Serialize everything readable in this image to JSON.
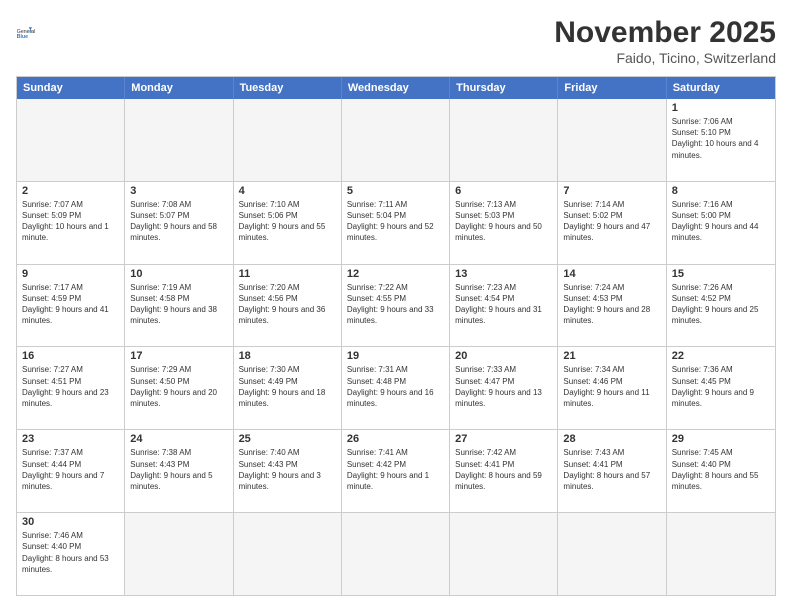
{
  "header": {
    "logo_general": "General",
    "logo_blue": "Blue",
    "month_year": "November 2025",
    "location": "Faido, Ticino, Switzerland"
  },
  "weekdays": [
    "Sunday",
    "Monday",
    "Tuesday",
    "Wednesday",
    "Thursday",
    "Friday",
    "Saturday"
  ],
  "weeks": [
    [
      {
        "day": "",
        "text": ""
      },
      {
        "day": "",
        "text": ""
      },
      {
        "day": "",
        "text": ""
      },
      {
        "day": "",
        "text": ""
      },
      {
        "day": "",
        "text": ""
      },
      {
        "day": "",
        "text": ""
      },
      {
        "day": "1",
        "text": "Sunrise: 7:06 AM\nSunset: 5:10 PM\nDaylight: 10 hours and 4 minutes."
      }
    ],
    [
      {
        "day": "2",
        "text": "Sunrise: 7:07 AM\nSunset: 5:09 PM\nDaylight: 10 hours and 1 minute."
      },
      {
        "day": "3",
        "text": "Sunrise: 7:08 AM\nSunset: 5:07 PM\nDaylight: 9 hours and 58 minutes."
      },
      {
        "day": "4",
        "text": "Sunrise: 7:10 AM\nSunset: 5:06 PM\nDaylight: 9 hours and 55 minutes."
      },
      {
        "day": "5",
        "text": "Sunrise: 7:11 AM\nSunset: 5:04 PM\nDaylight: 9 hours and 52 minutes."
      },
      {
        "day": "6",
        "text": "Sunrise: 7:13 AM\nSunset: 5:03 PM\nDaylight: 9 hours and 50 minutes."
      },
      {
        "day": "7",
        "text": "Sunrise: 7:14 AM\nSunset: 5:02 PM\nDaylight: 9 hours and 47 minutes."
      },
      {
        "day": "8",
        "text": "Sunrise: 7:16 AM\nSunset: 5:00 PM\nDaylight: 9 hours and 44 minutes."
      }
    ],
    [
      {
        "day": "9",
        "text": "Sunrise: 7:17 AM\nSunset: 4:59 PM\nDaylight: 9 hours and 41 minutes."
      },
      {
        "day": "10",
        "text": "Sunrise: 7:19 AM\nSunset: 4:58 PM\nDaylight: 9 hours and 38 minutes."
      },
      {
        "day": "11",
        "text": "Sunrise: 7:20 AM\nSunset: 4:56 PM\nDaylight: 9 hours and 36 minutes."
      },
      {
        "day": "12",
        "text": "Sunrise: 7:22 AM\nSunset: 4:55 PM\nDaylight: 9 hours and 33 minutes."
      },
      {
        "day": "13",
        "text": "Sunrise: 7:23 AM\nSunset: 4:54 PM\nDaylight: 9 hours and 31 minutes."
      },
      {
        "day": "14",
        "text": "Sunrise: 7:24 AM\nSunset: 4:53 PM\nDaylight: 9 hours and 28 minutes."
      },
      {
        "day": "15",
        "text": "Sunrise: 7:26 AM\nSunset: 4:52 PM\nDaylight: 9 hours and 25 minutes."
      }
    ],
    [
      {
        "day": "16",
        "text": "Sunrise: 7:27 AM\nSunset: 4:51 PM\nDaylight: 9 hours and 23 minutes."
      },
      {
        "day": "17",
        "text": "Sunrise: 7:29 AM\nSunset: 4:50 PM\nDaylight: 9 hours and 20 minutes."
      },
      {
        "day": "18",
        "text": "Sunrise: 7:30 AM\nSunset: 4:49 PM\nDaylight: 9 hours and 18 minutes."
      },
      {
        "day": "19",
        "text": "Sunrise: 7:31 AM\nSunset: 4:48 PM\nDaylight: 9 hours and 16 minutes."
      },
      {
        "day": "20",
        "text": "Sunrise: 7:33 AM\nSunset: 4:47 PM\nDaylight: 9 hours and 13 minutes."
      },
      {
        "day": "21",
        "text": "Sunrise: 7:34 AM\nSunset: 4:46 PM\nDaylight: 9 hours and 11 minutes."
      },
      {
        "day": "22",
        "text": "Sunrise: 7:36 AM\nSunset: 4:45 PM\nDaylight: 9 hours and 9 minutes."
      }
    ],
    [
      {
        "day": "23",
        "text": "Sunrise: 7:37 AM\nSunset: 4:44 PM\nDaylight: 9 hours and 7 minutes."
      },
      {
        "day": "24",
        "text": "Sunrise: 7:38 AM\nSunset: 4:43 PM\nDaylight: 9 hours and 5 minutes."
      },
      {
        "day": "25",
        "text": "Sunrise: 7:40 AM\nSunset: 4:43 PM\nDaylight: 9 hours and 3 minutes."
      },
      {
        "day": "26",
        "text": "Sunrise: 7:41 AM\nSunset: 4:42 PM\nDaylight: 9 hours and 1 minute."
      },
      {
        "day": "27",
        "text": "Sunrise: 7:42 AM\nSunset: 4:41 PM\nDaylight: 8 hours and 59 minutes."
      },
      {
        "day": "28",
        "text": "Sunrise: 7:43 AM\nSunset: 4:41 PM\nDaylight: 8 hours and 57 minutes."
      },
      {
        "day": "29",
        "text": "Sunrise: 7:45 AM\nSunset: 4:40 PM\nDaylight: 8 hours and 55 minutes."
      }
    ],
    [
      {
        "day": "30",
        "text": "Sunrise: 7:46 AM\nSunset: 4:40 PM\nDaylight: 8 hours and 53 minutes."
      },
      {
        "day": "",
        "text": ""
      },
      {
        "day": "",
        "text": ""
      },
      {
        "day": "",
        "text": ""
      },
      {
        "day": "",
        "text": ""
      },
      {
        "day": "",
        "text": ""
      },
      {
        "day": "",
        "text": ""
      }
    ]
  ]
}
